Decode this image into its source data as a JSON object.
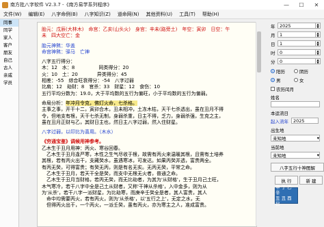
{
  "window": {
    "title": "南方批八字软件 V2.3.7 -《南方易学系列程序》"
  },
  "window_controls": [
    "—",
    "☐",
    "✕"
  ],
  "menu": [
    "文件(W)",
    "编辑(E)",
    "八字命例(B)",
    "八字知识(Z)",
    "道命网(N)",
    "其他资料(U)",
    "工具(T)",
    "帮助(H)"
  ],
  "nav": [
    "同事",
    "同学",
    "家人",
    "客户",
    "朋友",
    "自己",
    "古人",
    "亲戚",
    "学员"
  ],
  "content": {
    "l1": "胎元：戊辰(大林木)　命宫：乙亥(山头火)　身宫：辛未(路旁土)　年空：寅卯　日空：午",
    "l2": "未　四大空亡：金",
    "l3": "胎元神煞：华盖",
    "l4": "命宫神煞：驿马　亡神",
    "l5": "八字五行得分：",
    "l6": "木：12　水：8　　　　　同类得分：20",
    "l7": "火：10　土：20　　　　异类得分：45",
    "l8": "相差：-55　综合旺衰得分：-54　八字过弱",
    "l9": "比肩：12　劫财：8　官杀：33　财星：12　食伤：10",
    "l10": "五行平均分数为：19.0，大于平均数的五行为偏旺，小于平均数的五行为偏弱。",
    "l11a": "命局分析：",
    "l11b": "年冲月令克，佛灯火命，七杀格。",
    "l12": "主事之事，开干十二，寅卯合木，丑未相冲，土冻木枯，天干七杀透出，虽在丑月不得",
    "l13": "令，但地支有根，天干七杀无制，身弱杀重，日主不得，乏力，身弱杀强，生克之主，",
    "l14": "虽在丑月正财与乙，其财日主也，然日主八字过弱，然入住财星。",
    "l15": "八字过弱，以印比为喜用。（木水）",
    "l16": "《穷通宝鉴》调候用神参考。",
    "l17": "乙木生于丑月用神：丙火、寒谷回春。",
    "l18": "　乙木生于丑月逢严寒，木性之生气尽收于根，故需有丙火来温暖其根，且需有土培养",
    "l19": "其根，若有丙火出干，支藏癸水，虽遇寒冰，可发达。如果丙癸并透，富贵两全。",
    "l20": "有丙无癸，可得富贵；有癸无丙，则是有名无实。无丙无癸，平常之命。",
    "l21": "　乙木生于丑月，若天干全是癸，而支中无根无火者，普通之命。",
    "l22": "　乙木生于丑月当财格，若丙无癸，而无比劫者，为其为'从财格'，生于丑月己土旺，",
    "l23": "木气寒冷，若干八字中全是己土从财者，又称'干神从杀格'，入中金多，则为从",
    "l24": "为'从杀'，若干八字一派财星，为比劫寒，而庚辛壬癸全是者，其人富贵，其人",
    "l25": "　命中均需要丙火，若有丙火，则为'从杀格'，以'五行之上'，无定之水，无",
    "l26": "　但得丙火出干，一个丙火，一派壬癸，虽有丙火，亦为寒主之人，准成富贵。"
  },
  "side": {
    "year_label": "年",
    "year": "2025",
    "month_label": "月",
    "month": "1",
    "day_label": "日",
    "day": "1",
    "hour_label": "时",
    "hour": "0",
    "minute_label": "分",
    "minute": "0",
    "cal_solar": "阳历",
    "cal_lunar": "阴历",
    "sex_male": "男",
    "sex_female": "女",
    "leap_label": "农历闰月",
    "name_label": "姓名",
    "name_value": "",
    "year_start_label": "本运流日",
    "flow_year_label": "起入流年",
    "flow_year": "2025",
    "birthplace_label": "出生地",
    "birthplace": "未知地",
    "current_label": "当前地",
    "current": "未知地",
    "wuxing_button": "八字五行十神图解",
    "execute_button": "执 行",
    "new_button": "新 建",
    "tile1_a": "甲 丁 乙 辛",
    "tile1_b": "丑 丑 酉 巳"
  }
}
